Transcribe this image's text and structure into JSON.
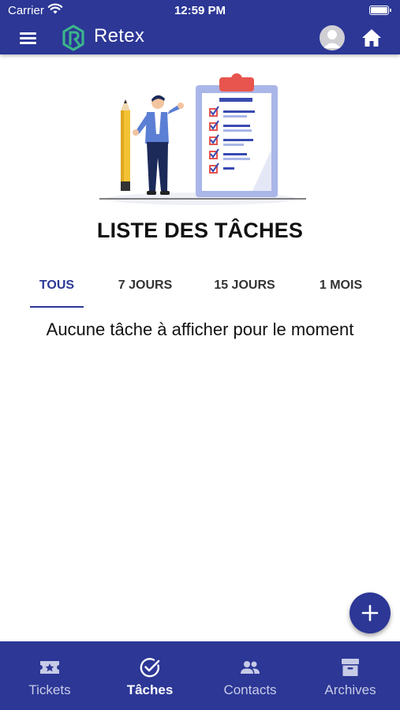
{
  "status_bar": {
    "carrier": "Carrier",
    "time": "12:59 PM"
  },
  "app_bar": {
    "title": "Retex",
    "menu_icon": "menu-icon",
    "avatar_icon": "user-avatar-icon",
    "home_icon": "home-icon"
  },
  "page": {
    "title": "LISTE DES TÂCHES",
    "empty_message": "Aucune tâche à afficher pour le moment"
  },
  "tabs": [
    {
      "label": "TOUS",
      "active": true
    },
    {
      "label": "7 JOURS",
      "active": false
    },
    {
      "label": "15 JOURS",
      "active": false
    },
    {
      "label": "1 MOIS",
      "active": false
    }
  ],
  "fab": {
    "icon": "plus-icon"
  },
  "bottom_nav": [
    {
      "label": "Tickets",
      "icon": "ticket-icon",
      "active": false
    },
    {
      "label": "Tâches",
      "icon": "check-circle-icon",
      "active": true
    },
    {
      "label": "Contacts",
      "icon": "people-icon",
      "active": false
    },
    {
      "label": "Archives",
      "icon": "archive-icon",
      "active": false
    }
  ],
  "colors": {
    "primary": "#2c3796",
    "accent_green": "#3bb58a",
    "active_label": "#ffffff",
    "inactive_label": "#c8cbe6"
  }
}
